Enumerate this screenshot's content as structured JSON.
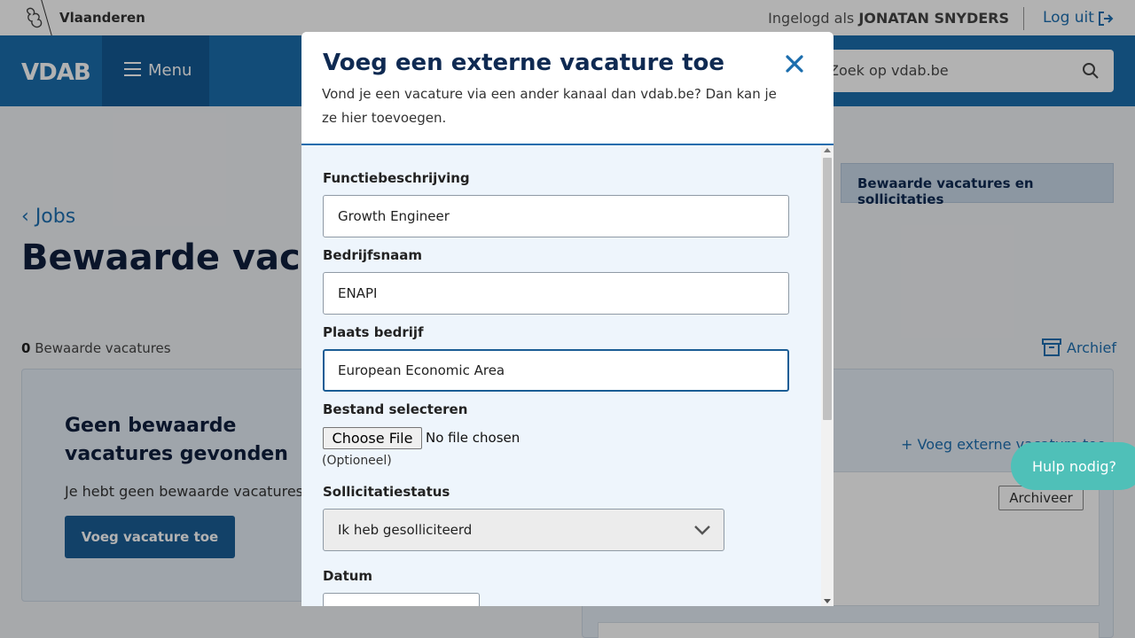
{
  "topbar": {
    "site_label": "Vlaanderen",
    "login_prefix": "Ingelogd als",
    "user_name": "JONATAN SNYDERS",
    "logout_label": "Log uit"
  },
  "navbar": {
    "brand": "VDAB",
    "menu_label": "Menu",
    "search_placeholder": "Zoek op vdab.be"
  },
  "page": {
    "back_label": "Jobs",
    "title": "Bewaarde vacatures",
    "tab_saved": "Bewaarde vacatures en sollicitaties",
    "count": "0",
    "count_label": "Bewaarde vacatures",
    "archive_label": "Archief",
    "empty_title": "Geen bewaarde vacatures gevonden",
    "empty_text": "Je hebt geen bewaarde vacatures.",
    "empty_button": "Voeg vacature toe",
    "add_external": "Voeg externe vacature toe",
    "archive_button": "Archiveer",
    "help_label": "Hulp nodig?"
  },
  "modal": {
    "title": "Voeg een externe vacature toe",
    "subtitle": "Vond je een vacature via een ander kanaal dan vdab.be? Dan kan je ze hier toevoegen.",
    "fields": {
      "function_label": "Functiebeschrijving",
      "function_value": "Growth Engineer",
      "company_label": "Bedrijfsnaam",
      "company_value": "ENAPI",
      "location_label": "Plaats bedrijf",
      "location_value": "European Economic Area",
      "file_label": "Bestand selecteren",
      "file_button": "Choose File",
      "file_status": "No file chosen",
      "file_optional": "(Optioneel)",
      "status_label": "Sollicitatiestatus",
      "status_value": "Ik heb gesolliciteerd",
      "date_label": "Datum"
    }
  },
  "colors": {
    "brand_blue": "#1b6dad",
    "dark_blue": "#145a94",
    "help_teal": "#4fc0b8"
  }
}
